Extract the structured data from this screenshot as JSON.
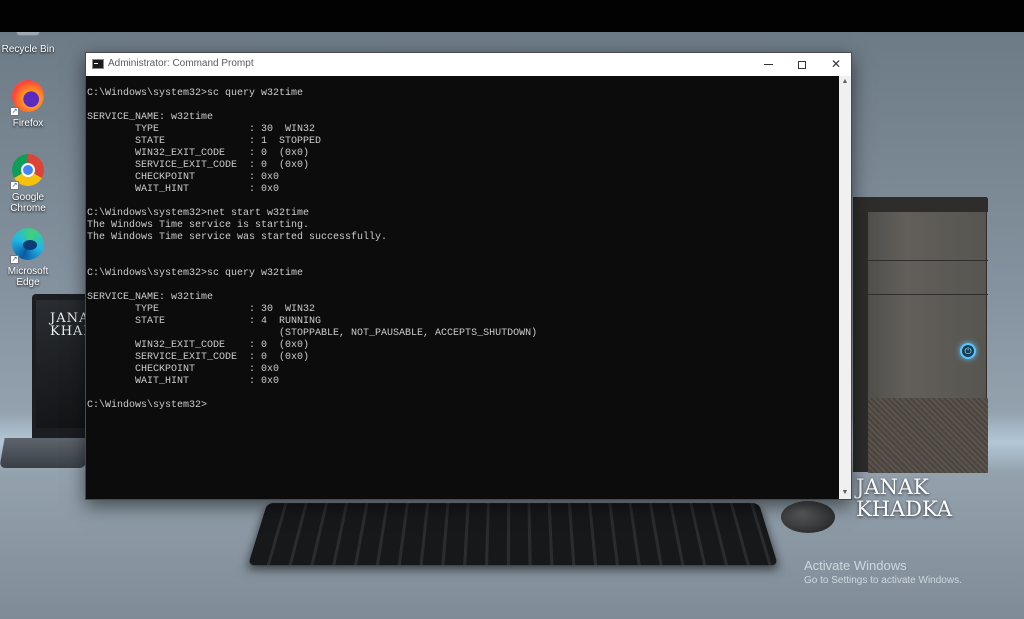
{
  "desktop": {
    "icons": [
      {
        "label": "Recycle Bin",
        "icon": "recycle-bin-icon"
      },
      {
        "label": "Firefox",
        "icon": "firefox-icon"
      },
      {
        "label": "Google\nChrome",
        "icon": "chrome-icon"
      },
      {
        "label": "Microsoft\nEdge",
        "icon": "edge-icon"
      }
    ],
    "laptop_text": "JANA\nKHADK",
    "brand": "JANAK\nKHADKA",
    "activation": {
      "title": "Activate Windows",
      "subtitle": "Go to Settings to activate Windows."
    }
  },
  "window": {
    "title": "Administrator: Command Prompt",
    "console_lines": [
      "C:\\Windows\\system32>sc query w32time",
      "",
      "SERVICE_NAME: w32time",
      "        TYPE               : 30  WIN32",
      "        STATE              : 1  STOPPED",
      "        WIN32_EXIT_CODE    : 0  (0x0)",
      "        SERVICE_EXIT_CODE  : 0  (0x0)",
      "        CHECKPOINT         : 0x0",
      "        WAIT_HINT          : 0x0",
      "",
      "C:\\Windows\\system32>net start w32time",
      "The Windows Time service is starting.",
      "The Windows Time service was started successfully.",
      "",
      "",
      "C:\\Windows\\system32>sc query w32time",
      "",
      "SERVICE_NAME: w32time",
      "        TYPE               : 30  WIN32",
      "        STATE              : 4  RUNNING",
      "                                (STOPPABLE, NOT_PAUSABLE, ACCEPTS_SHUTDOWN)",
      "        WIN32_EXIT_CODE    : 0  (0x0)",
      "        SERVICE_EXIT_CODE  : 0  (0x0)",
      "        CHECKPOINT         : 0x0",
      "        WAIT_HINT          : 0x0",
      "",
      "C:\\Windows\\system32>"
    ]
  }
}
